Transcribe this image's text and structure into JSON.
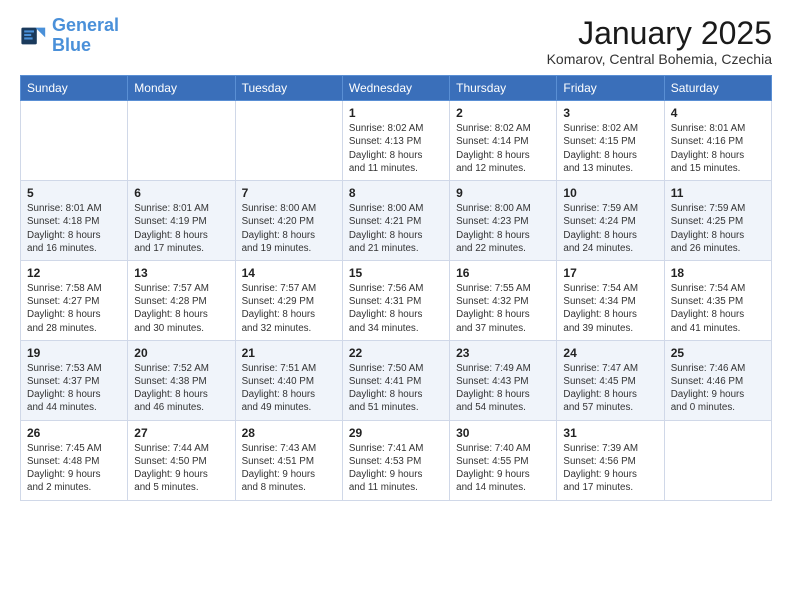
{
  "logo": {
    "line1": "General",
    "line2": "Blue"
  },
  "title": "January 2025",
  "location": "Komarov, Central Bohemia, Czechia",
  "days": [
    "Sunday",
    "Monday",
    "Tuesday",
    "Wednesday",
    "Thursday",
    "Friday",
    "Saturday"
  ],
  "weeks": [
    [
      {
        "date": "",
        "content": ""
      },
      {
        "date": "",
        "content": ""
      },
      {
        "date": "",
        "content": ""
      },
      {
        "date": "1",
        "content": "Sunrise: 8:02 AM\nSunset: 4:13 PM\nDaylight: 8 hours\nand 11 minutes."
      },
      {
        "date": "2",
        "content": "Sunrise: 8:02 AM\nSunset: 4:14 PM\nDaylight: 8 hours\nand 12 minutes."
      },
      {
        "date": "3",
        "content": "Sunrise: 8:02 AM\nSunset: 4:15 PM\nDaylight: 8 hours\nand 13 minutes."
      },
      {
        "date": "4",
        "content": "Sunrise: 8:01 AM\nSunset: 4:16 PM\nDaylight: 8 hours\nand 15 minutes."
      }
    ],
    [
      {
        "date": "5",
        "content": "Sunrise: 8:01 AM\nSunset: 4:18 PM\nDaylight: 8 hours\nand 16 minutes."
      },
      {
        "date": "6",
        "content": "Sunrise: 8:01 AM\nSunset: 4:19 PM\nDaylight: 8 hours\nand 17 minutes."
      },
      {
        "date": "7",
        "content": "Sunrise: 8:00 AM\nSunset: 4:20 PM\nDaylight: 8 hours\nand 19 minutes."
      },
      {
        "date": "8",
        "content": "Sunrise: 8:00 AM\nSunset: 4:21 PM\nDaylight: 8 hours\nand 21 minutes."
      },
      {
        "date": "9",
        "content": "Sunrise: 8:00 AM\nSunset: 4:23 PM\nDaylight: 8 hours\nand 22 minutes."
      },
      {
        "date": "10",
        "content": "Sunrise: 7:59 AM\nSunset: 4:24 PM\nDaylight: 8 hours\nand 24 minutes."
      },
      {
        "date": "11",
        "content": "Sunrise: 7:59 AM\nSunset: 4:25 PM\nDaylight: 8 hours\nand 26 minutes."
      }
    ],
    [
      {
        "date": "12",
        "content": "Sunrise: 7:58 AM\nSunset: 4:27 PM\nDaylight: 8 hours\nand 28 minutes."
      },
      {
        "date": "13",
        "content": "Sunrise: 7:57 AM\nSunset: 4:28 PM\nDaylight: 8 hours\nand 30 minutes."
      },
      {
        "date": "14",
        "content": "Sunrise: 7:57 AM\nSunset: 4:29 PM\nDaylight: 8 hours\nand 32 minutes."
      },
      {
        "date": "15",
        "content": "Sunrise: 7:56 AM\nSunset: 4:31 PM\nDaylight: 8 hours\nand 34 minutes."
      },
      {
        "date": "16",
        "content": "Sunrise: 7:55 AM\nSunset: 4:32 PM\nDaylight: 8 hours\nand 37 minutes."
      },
      {
        "date": "17",
        "content": "Sunrise: 7:54 AM\nSunset: 4:34 PM\nDaylight: 8 hours\nand 39 minutes."
      },
      {
        "date": "18",
        "content": "Sunrise: 7:54 AM\nSunset: 4:35 PM\nDaylight: 8 hours\nand 41 minutes."
      }
    ],
    [
      {
        "date": "19",
        "content": "Sunrise: 7:53 AM\nSunset: 4:37 PM\nDaylight: 8 hours\nand 44 minutes."
      },
      {
        "date": "20",
        "content": "Sunrise: 7:52 AM\nSunset: 4:38 PM\nDaylight: 8 hours\nand 46 minutes."
      },
      {
        "date": "21",
        "content": "Sunrise: 7:51 AM\nSunset: 4:40 PM\nDaylight: 8 hours\nand 49 minutes."
      },
      {
        "date": "22",
        "content": "Sunrise: 7:50 AM\nSunset: 4:41 PM\nDaylight: 8 hours\nand 51 minutes."
      },
      {
        "date": "23",
        "content": "Sunrise: 7:49 AM\nSunset: 4:43 PM\nDaylight: 8 hours\nand 54 minutes."
      },
      {
        "date": "24",
        "content": "Sunrise: 7:47 AM\nSunset: 4:45 PM\nDaylight: 8 hours\nand 57 minutes."
      },
      {
        "date": "25",
        "content": "Sunrise: 7:46 AM\nSunset: 4:46 PM\nDaylight: 9 hours\nand 0 minutes."
      }
    ],
    [
      {
        "date": "26",
        "content": "Sunrise: 7:45 AM\nSunset: 4:48 PM\nDaylight: 9 hours\nand 2 minutes."
      },
      {
        "date": "27",
        "content": "Sunrise: 7:44 AM\nSunset: 4:50 PM\nDaylight: 9 hours\nand 5 minutes."
      },
      {
        "date": "28",
        "content": "Sunrise: 7:43 AM\nSunset: 4:51 PM\nDaylight: 9 hours\nand 8 minutes."
      },
      {
        "date": "29",
        "content": "Sunrise: 7:41 AM\nSunset: 4:53 PM\nDaylight: 9 hours\nand 11 minutes."
      },
      {
        "date": "30",
        "content": "Sunrise: 7:40 AM\nSunset: 4:55 PM\nDaylight: 9 hours\nand 14 minutes."
      },
      {
        "date": "31",
        "content": "Sunrise: 7:39 AM\nSunset: 4:56 PM\nDaylight: 9 hours\nand 17 minutes."
      },
      {
        "date": "",
        "content": ""
      }
    ]
  ]
}
